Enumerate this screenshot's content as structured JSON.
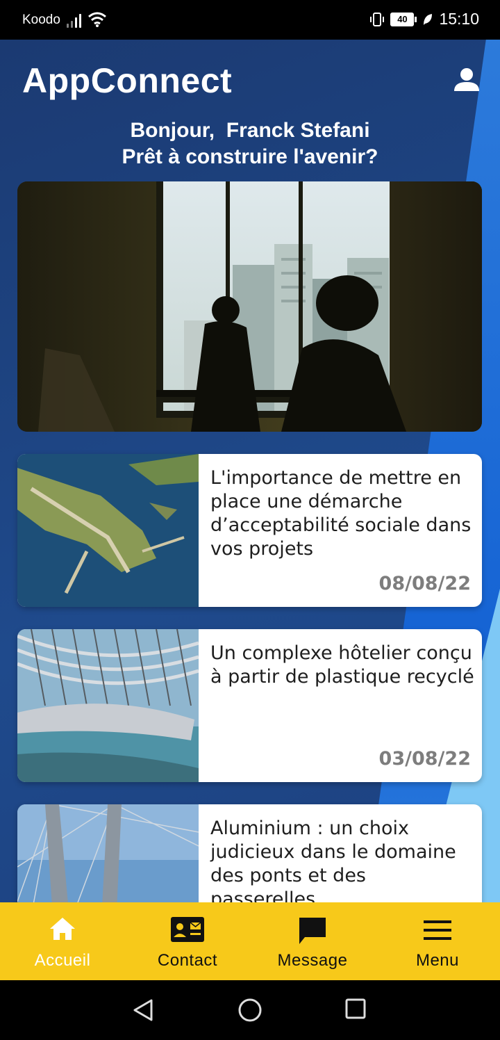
{
  "status_bar": {
    "carrier": "Koodo",
    "battery": "40",
    "time": "15:10"
  },
  "header": {
    "app_title": "AppConnect",
    "profile_icon": "person-icon"
  },
  "greeting": {
    "line1": "Bonjour,  Franck Stefani",
    "line2": "Prêt à construire l'avenir?"
  },
  "hero": {
    "image": "construction-workers-silhouette-window"
  },
  "articles": [
    {
      "title": "L'importance de mettre en place une démarche d’acceptabilité sociale dans vos projets",
      "date": "08/08/22",
      "image": "aerial-coastline-pier"
    },
    {
      "title": "Un complexe hôtelier conçu à partir de plastique recyclé",
      "date": "03/08/22",
      "image": "futuristic-hotel-structure"
    },
    {
      "title": "Aluminium : un choix judicieux dans le domaine des ponts et des passerelles",
      "date": "",
      "image": "cable-stayed-bridge"
    }
  ],
  "bottom_nav": [
    {
      "label": "Accueil",
      "icon": "home-icon",
      "active": true
    },
    {
      "label": "Contact",
      "icon": "contact-card-icon",
      "active": false
    },
    {
      "label": "Message",
      "icon": "chat-icon",
      "active": false
    },
    {
      "label": "Menu",
      "icon": "hamburger-icon",
      "active": false
    }
  ],
  "colors": {
    "nav_bg": "#f7c91a",
    "app_bg": "#1f4a8c",
    "active_label": "#ffffff"
  }
}
